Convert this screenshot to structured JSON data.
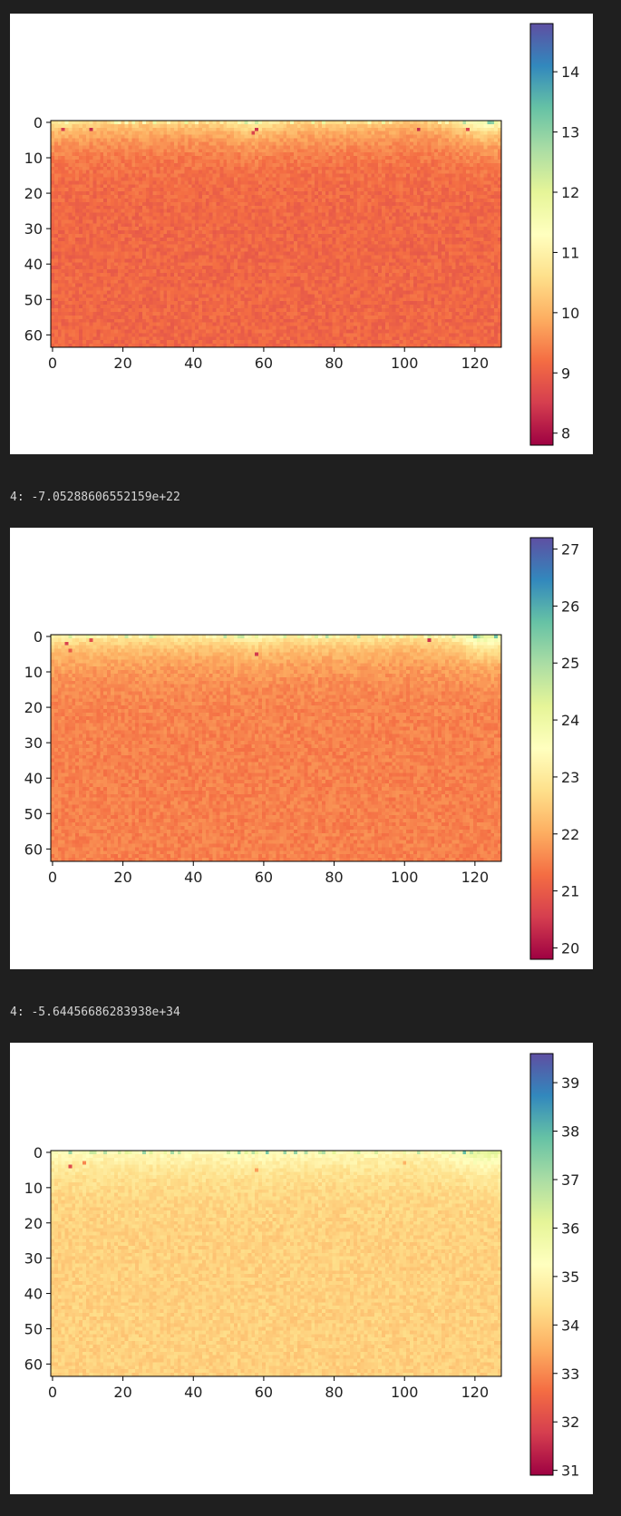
{
  "outputs": [
    {
      "text": "4: -7.05288606552159e+22"
    },
    {
      "text": "4: -5.64456686283938e+34"
    }
  ],
  "chart_data": [
    {
      "type": "heatmap",
      "colormap": "Spectral",
      "grid": false,
      "xlim": [
        0,
        128
      ],
      "ylim": [
        64,
        0
      ],
      "xticks": [
        0,
        20,
        40,
        60,
        80,
        100,
        120
      ],
      "yticks": [
        0,
        10,
        20,
        30,
        40,
        50,
        60
      ],
      "colorbar": {
        "min": 7.8,
        "max": 14.8,
        "ticks": [
          8,
          9,
          10,
          11,
          12,
          13,
          14
        ],
        "placement": "right"
      },
      "base": 9.1,
      "top": 10.4,
      "blobs": [
        [
          3,
          10.7
        ],
        [
          57,
          11.0
        ],
        [
          101,
          10.2
        ],
        [
          123,
          11.6
        ]
      ],
      "hot": [
        [
          3,
          2,
          8.5
        ],
        [
          11,
          2,
          8.3
        ],
        [
          58,
          2,
          8.4
        ],
        [
          57,
          3,
          8.6
        ],
        [
          104,
          2,
          8.3
        ],
        [
          118,
          2,
          8.6
        ]
      ],
      "title": "",
      "xlabel": "",
      "ylabel": ""
    },
    {
      "type": "heatmap",
      "colormap": "Spectral",
      "grid": false,
      "xlim": [
        0,
        128
      ],
      "ylim": [
        64,
        0
      ],
      "xticks": [
        0,
        20,
        40,
        60,
        80,
        100,
        120
      ],
      "yticks": [
        0,
        10,
        20,
        30,
        40,
        50,
        60
      ],
      "colorbar": {
        "min": 19.8,
        "max": 27.2,
        "ticks": [
          20,
          21,
          22,
          23,
          24,
          25,
          26,
          27
        ],
        "placement": "right"
      },
      "base": 21.5,
      "top": 23.0,
      "blobs": [
        [
          3,
          23.2
        ],
        [
          57,
          23.3
        ],
        [
          101,
          22.8
        ],
        [
          123,
          24.3
        ]
      ],
      "hot": [
        [
          4,
          2,
          20.6
        ],
        [
          5,
          4,
          21.0
        ],
        [
          11,
          1,
          20.8
        ],
        [
          58,
          5,
          20.5
        ],
        [
          107,
          1,
          20.4
        ]
      ],
      "title": "",
      "xlabel": "",
      "ylabel": ""
    },
    {
      "type": "heatmap",
      "colormap": "Spectral",
      "grid": false,
      "xlim": [
        0,
        128
      ],
      "ylim": [
        64,
        0
      ],
      "xticks": [
        0,
        20,
        40,
        60,
        80,
        100,
        120
      ],
      "yticks": [
        0,
        10,
        20,
        30,
        40,
        50,
        60
      ],
      "colorbar": {
        "min": 30.9,
        "max": 39.6,
        "ticks": [
          31,
          32,
          33,
          34,
          35,
          36,
          37,
          38,
          39
        ],
        "placement": "right"
      },
      "base": 34.1,
      "top": 35.2,
      "blobs": [
        [
          3,
          35.3
        ],
        [
          57,
          35.4
        ],
        [
          101,
          35.0
        ],
        [
          123,
          36.2
        ]
      ],
      "hot": [
        [
          5,
          4,
          32.0
        ],
        [
          9,
          3,
          33.0
        ],
        [
          58,
          5,
          33.3
        ],
        [
          100,
          3,
          33.6
        ]
      ],
      "title": "",
      "xlabel": "",
      "ylabel": ""
    }
  ]
}
